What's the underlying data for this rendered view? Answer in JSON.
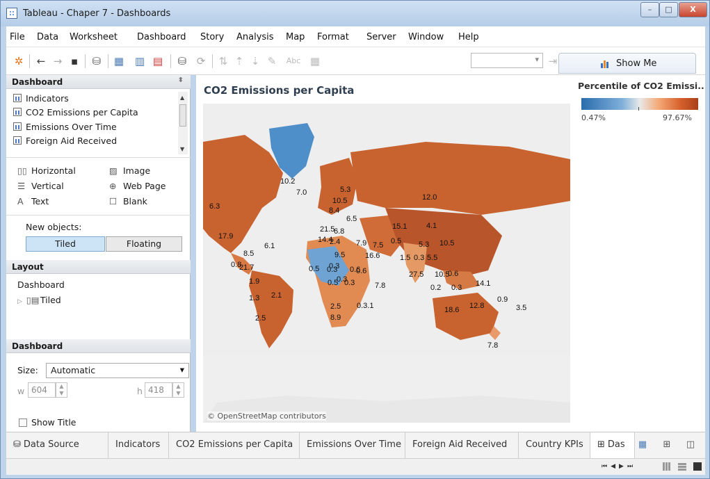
{
  "window": {
    "title": "Tableau - Chaper 7 - Dashboards",
    "controls": [
      "–",
      "□",
      "X"
    ]
  },
  "menu": [
    "File",
    "Data",
    "Worksheet",
    "Dashboard",
    "Story",
    "Analysis",
    "Map",
    "Format",
    "Server",
    "Window",
    "Help"
  ],
  "toolbar": {
    "show_me": "Show Me",
    "abc": "Abc"
  },
  "left": {
    "dashboard_header": "Dashboard",
    "sheets": [
      "Indicators",
      "CO2 Emissions per Capita",
      "Emissions Over Time",
      "Foreign Aid Received"
    ],
    "objects": [
      {
        "label": "Horizontal",
        "icon": "horizontal-icon"
      },
      {
        "label": "Image",
        "icon": "image-icon"
      },
      {
        "label": "Vertical",
        "icon": "vertical-icon"
      },
      {
        "label": "Web Page",
        "icon": "globe-icon"
      },
      {
        "label": "Text",
        "icon": "text-icon"
      },
      {
        "label": "Blank",
        "icon": "blank-icon"
      }
    ],
    "new_objects_label": "New objects:",
    "tiled": "Tiled",
    "floating": "Floating",
    "layout_header": "Layout",
    "layout_root": "Dashboard",
    "layout_child": "Tiled",
    "dashboard_header2": "Dashboard",
    "size_label": "Size:",
    "size_value": "Automatic",
    "w_label": "w",
    "w_value": "604",
    "h_label": "h",
    "h_value": "418",
    "show_title": "Show Title"
  },
  "canvas": {
    "title": "CO2 Emissions per Capita",
    "legend_title": "Percentile of CO2 Emissi..",
    "legend_min": "0.47%",
    "legend_max": "97.67%",
    "credit": "© OpenStreetMap contributors",
    "map_labels": [
      "10.2",
      "7.0",
      "6.3",
      "5.3",
      "10.5",
      "8.4",
      "6.5",
      "12.0",
      "17.9",
      "6.1",
      "21.5",
      "6.8",
      "15.1",
      "4.1",
      "14.4",
      "2.4",
      "7.9",
      "7.5",
      "0.5",
      "5.3",
      "10.5",
      "8.5",
      "9.5",
      "16.6",
      "0.8",
      "21.7",
      "1.5",
      "0.3",
      "5.5",
      "0.3",
      "0.5",
      "0.3",
      "0.6",
      "0.6",
      "27.5",
      "10.5",
      "0.6",
      "0.3",
      "1.9",
      "0.5",
      "0.3",
      "7.8",
      "0.2",
      "0.3",
      "14.1",
      "1.3",
      "2.1",
      "2.5",
      "0.3.1",
      "18.6",
      "12.8",
      "0.9",
      "3.5",
      "2.5",
      "8.9",
      "7.8"
    ]
  },
  "tabs": [
    "Data Source",
    "Indicators",
    "CO2 Emissions per Capita",
    "Emissions Over Time",
    "Foreign Aid Received",
    "Country KPIs",
    "Das"
  ],
  "colors": {
    "low": "#2a6cac",
    "high": "#a9401a",
    "accent": "#cde4f7"
  }
}
